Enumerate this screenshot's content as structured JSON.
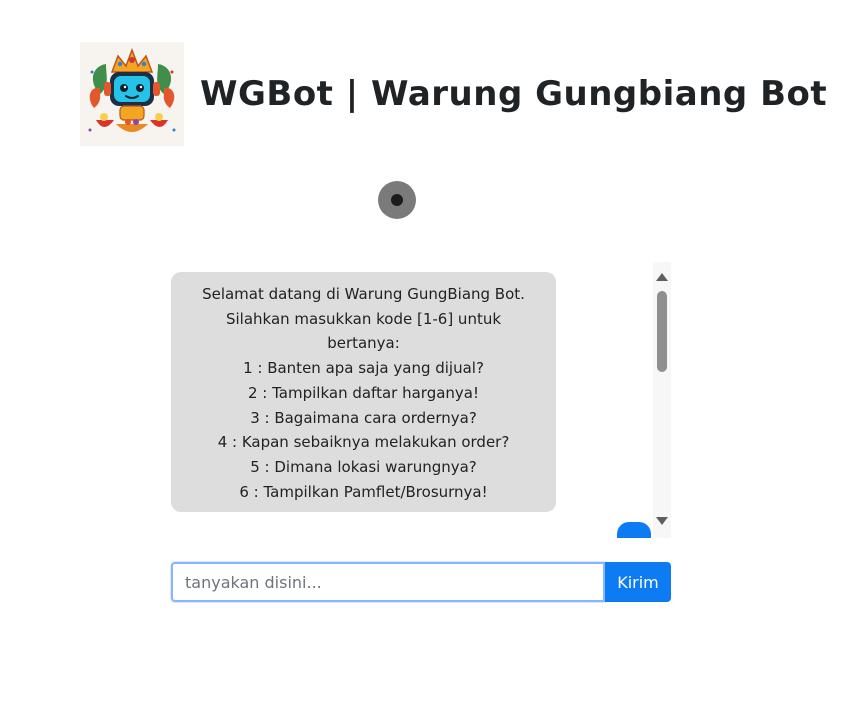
{
  "header": {
    "logo_icon": "robot-mascot-logo",
    "title": "WGBot | Warung Gungbiang Bot"
  },
  "voice": {
    "icon": "record-icon"
  },
  "chat": {
    "messages": [
      {
        "sender": "bot",
        "lines": [
          "Selamat datang di Warung GungBiang Bot.",
          "Silahkan masukkan kode [1-6] untuk",
          "bertanya:",
          "1 : Banten apa saja yang dijual?",
          "2 : Tampilkan daftar harganya!",
          "3 : Bagaimana cara ordernya?",
          "4 : Kapan sebaiknya melakukan order?",
          "5 : Dimana lokasi warungnya?",
          "6 : Tampilkan Pamflet/Brosurnya!"
        ]
      },
      {
        "sender": "user",
        "text": ""
      }
    ]
  },
  "input": {
    "placeholder": "tanyakan disini...",
    "value": ""
  },
  "send_button": {
    "label": "Kirim"
  },
  "colors": {
    "accent": "#0d7cf2",
    "bot_bubble": "#dddddd",
    "record_button": "#7a7a7a"
  }
}
